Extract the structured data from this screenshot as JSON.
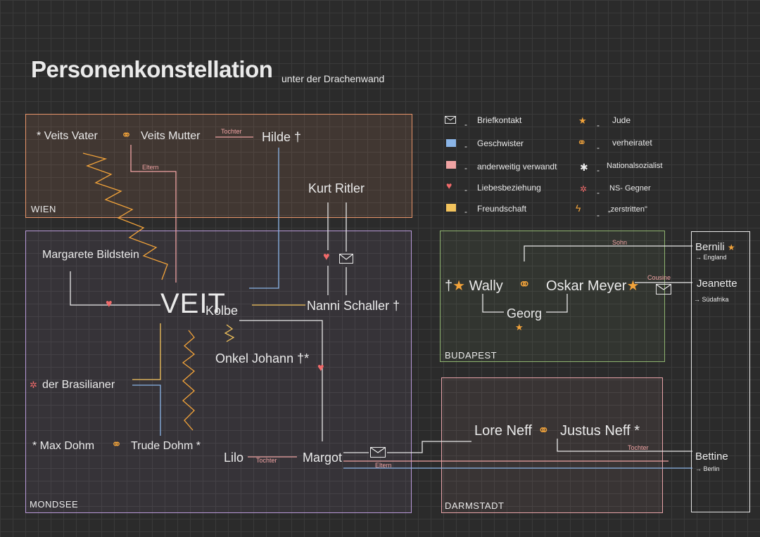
{
  "title": "Personenkonstellation",
  "subtitle": "unter der Drachenwand",
  "regions": {
    "wien": "WIEN",
    "mondsee": "MONDSEE",
    "budapest": "BUDAPEST",
    "darmstadt": "DARMSTADT"
  },
  "colors": {
    "wien": "#e8956a",
    "mondsee": "#b99ad9",
    "budapest": "#8fb470",
    "darmstadt": "#e7a3a8",
    "geschwister": "#8ab4e6",
    "verwandt": "#f0a3a3",
    "liebe": "#f06a6a",
    "freundschaft": "#f2c35c",
    "zerstritten": "#f2a33a",
    "jude": "#f2a33a"
  },
  "persons": {
    "veits_vater": "* Veits Vater",
    "veits_mutter": "Veits Mutter",
    "hilde": "Hilde †",
    "kurt_ritler": "Kurt Ritler",
    "margarete": "Margarete Bildstein",
    "veit": "VEIT",
    "kolbe": "Kolbe",
    "nanni": "Nanni Schaller †",
    "onkel": "Onkel Johann †*",
    "brasilianer": "der Brasilianer",
    "max": "* Max Dohm",
    "trude": "Trude Dohm *",
    "lilo": "Lilo",
    "margot": "Margot",
    "wally": "Wally",
    "oskar": "Oskar Meyer",
    "georg": "Georg",
    "lore": "Lore Neff",
    "justus": "Justus Neff *",
    "bernili": "Bernili",
    "bernili_note": "→ England",
    "jeanette": "Jeanette",
    "jeanette_note": "→ Südafrika",
    "bettine": "Bettine",
    "bettine_note": "→ Berlin"
  },
  "relation_labels": {
    "tochter_hilde": "Tochter",
    "eltern_veit": "Eltern",
    "tochter_lilo": "Tochter",
    "eltern_margot": "Eltern",
    "sohn": "Sohn",
    "cousine": "Cousine",
    "tochter_bettine": "Tochter"
  },
  "legend": [
    {
      "icon": "envelope-icon",
      "label": "Briefkontakt"
    },
    {
      "icon": "geschwister-swatch",
      "label": "Geschwister"
    },
    {
      "icon": "verwandt-swatch",
      "label": "anderweitig verwandt"
    },
    {
      "icon": "heart-icon",
      "label": "Liebesbeziehung"
    },
    {
      "icon": "freundschaft-swatch",
      "label": "Freundschaft"
    },
    {
      "icon": "star-icon",
      "label": "Jude"
    },
    {
      "icon": "rings-icon",
      "label": "verheiratet"
    },
    {
      "icon": "asterisk-icon",
      "label": "Nationalsozialist"
    },
    {
      "icon": "ns-gegner-icon",
      "label": "NS- Gegner"
    },
    {
      "icon": "zigzag-icon",
      "label": "„zerstritten\""
    }
  ]
}
